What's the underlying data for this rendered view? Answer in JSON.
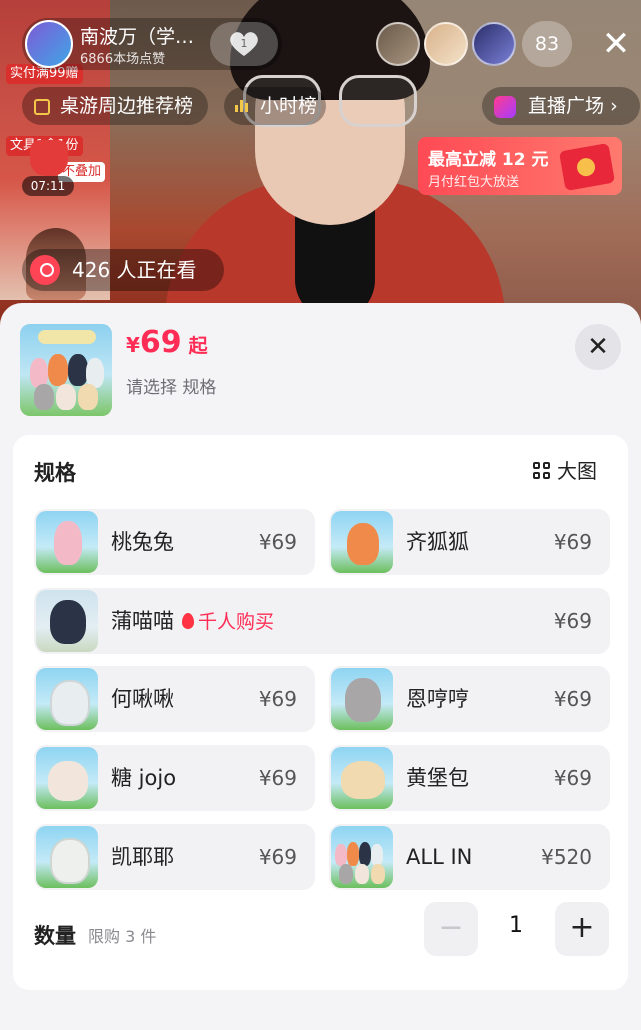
{
  "stream": {
    "anchor_name": "南波万（学…",
    "anchor_likes": "6866本场点赞",
    "follow_count": "1",
    "viewer_count": "83",
    "watching_text": "426 人正在看",
    "timer": "07:11",
    "shop_tags": [
      "实付满99赠",
      "文具1盒1份",
      "不叠加"
    ]
  },
  "pills": {
    "rank_label": "桌游周边推荐榜",
    "hour_rank_label": "小时榜",
    "plaza_label": "直播广场 ›"
  },
  "promo": {
    "title": "最高立减 12 元",
    "subtitle": "月付红包大放送"
  },
  "sheet": {
    "currency": "¥",
    "price": "69",
    "price_suffix": "起",
    "choose_hint": "请选择 规格",
    "close": "✕"
  },
  "spec": {
    "title": "规格",
    "big_view": "大图",
    "hot_label": "千人购买",
    "options": [
      {
        "name": "桃兔兔",
        "price": "¥69",
        "color": "#f4b9c7"
      },
      {
        "name": "齐狐狐",
        "price": "¥69",
        "color": "#f08a4b"
      },
      {
        "name": "蒲喵喵",
        "price": "¥69",
        "color": "#2b3446"
      },
      {
        "name": "何啾啾",
        "price": "¥69",
        "color": "#e8eef0"
      },
      {
        "name": "恩哼哼",
        "price": "¥69",
        "color": "#a9a6a8"
      },
      {
        "name": "糖 jojo",
        "price": "¥69",
        "color": "#f2e6dc"
      },
      {
        "name": "黄堡包",
        "price": "¥69",
        "color": "#f1d9b0"
      },
      {
        "name": "凯耶耶",
        "price": "¥69",
        "color": "#eef0ee"
      },
      {
        "name": "ALL IN",
        "price": "¥520",
        "color": "#f4b9c7"
      }
    ]
  },
  "quantity": {
    "label": "数量",
    "limit": "限购 3 件",
    "minus": "−",
    "value": "1",
    "plus": "+"
  },
  "colors": {
    "accent": "#ff2d55",
    "sheet_bg": "#f4f4f6",
    "option_bg": "#f2f2f5"
  }
}
